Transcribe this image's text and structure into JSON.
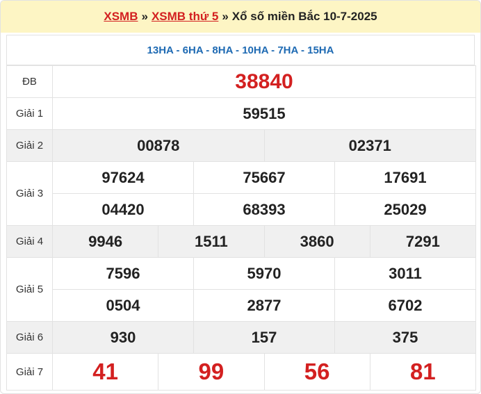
{
  "header": {
    "link1": "XSMB",
    "separator1": "»",
    "link2": "XSMB thứ 5",
    "separator2": "»",
    "title": "Xổ số miền Bắc 10-7-2025"
  },
  "codes": "13HA - 6HA - 8HA - 10HA - 7HA - 15HA",
  "prizes": {
    "db": {
      "label": "ĐB",
      "numbers": [
        "38840"
      ]
    },
    "g1": {
      "label": "Giải 1",
      "numbers": [
        "59515"
      ]
    },
    "g2": {
      "label": "Giải 2",
      "numbers": [
        "00878",
        "02371"
      ]
    },
    "g3": {
      "label": "Giải 3",
      "numbers": [
        "97624",
        "75667",
        "17691",
        "04420",
        "68393",
        "25029"
      ]
    },
    "g4": {
      "label": "Giải 4",
      "numbers": [
        "9946",
        "1511",
        "3860",
        "7291"
      ]
    },
    "g5": {
      "label": "Giải 5",
      "numbers": [
        "7596",
        "5970",
        "3011",
        "0504",
        "2877",
        "6702"
      ]
    },
    "g6": {
      "label": "Giải 6",
      "numbers": [
        "930",
        "157",
        "375"
      ]
    },
    "g7": {
      "label": "Giải 7",
      "numbers": [
        "41",
        "99",
        "56",
        "81"
      ]
    }
  },
  "colors": {
    "accent_red": "#d32020",
    "code_blue": "#1e6ab3",
    "header_bg": "#fdf5c4",
    "shade_bg": "#f0f0f0"
  }
}
